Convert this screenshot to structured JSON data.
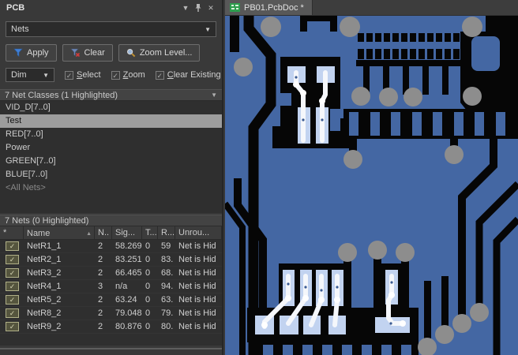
{
  "icons": {
    "combo_arrow": "▼",
    "panel_menu": "▼",
    "close": "✕",
    "check": "✓",
    "sort_asc": "▲"
  },
  "colors": {
    "panel_bg": "#393939",
    "list_bg": "#2f2f2f",
    "selected_row": "#9d9d9d",
    "board_copper_blue": "#4467a3",
    "board_clearance_black": "#060606",
    "via_gray": "#8d8d8d",
    "highlight_pad_blue": "#c2d3f0",
    "highlight_trace_white": "#f5f7fb",
    "checkbox_khaki": "#b0b088",
    "apply_funnel_blue": "#3f7fd6",
    "clear_x_red": "#d23c3c",
    "tab_icon_green": "#2e9e4e"
  },
  "panel": {
    "title": "PCB",
    "filter_combo": {
      "value": "Nets"
    },
    "toolbar": {
      "apply": "Apply",
      "clear": "Clear",
      "zoom_level": "Zoom Level..."
    },
    "dim_combo": {
      "value": "Dim"
    },
    "options": [
      {
        "key": "S",
        "rest": "elect"
      },
      {
        "key": "Z",
        "rest": "oom"
      },
      {
        "key": "C",
        "rest": "lear Existing"
      }
    ],
    "classes": {
      "header": "7 Net Classes (1 Highlighted)",
      "items": [
        "VID_D[7..0]",
        "Test",
        "RED[7..0]",
        "Power",
        "GREEN[7..0]",
        "BLUE[7..0]",
        "<All Nets>"
      ],
      "selected": "Test"
    },
    "nets": {
      "header": "7 Nets (0 Highlighted)",
      "columns": [
        "*",
        "Name",
        "N..",
        "Sig...",
        "T...",
        "R...",
        "Unrou..."
      ],
      "rows": [
        {
          "name": "NetR1_1",
          "nodes": "2",
          "signal": "58.269",
          "t": "0",
          "routed": "59",
          "unrouted": "Net is Hid"
        },
        {
          "name": "NetR2_1",
          "nodes": "2",
          "signal": "83.251",
          "t": "0",
          "routed": "83.",
          "unrouted": "Net is Hid"
        },
        {
          "name": "NetR3_2",
          "nodes": "2",
          "signal": "66.465",
          "t": "0",
          "routed": "68.",
          "unrouted": "Net is Hid"
        },
        {
          "name": "NetR4_1",
          "nodes": "3",
          "signal": "n/a",
          "t": "0",
          "routed": "94.",
          "unrouted": "Net is Hid"
        },
        {
          "name": "NetR5_2",
          "nodes": "2",
          "signal": "63.24",
          "t": "0",
          "routed": "63.",
          "unrouted": "Net is Hid"
        },
        {
          "name": "NetR8_2",
          "nodes": "2",
          "signal": "79.048",
          "t": "0",
          "routed": "79.",
          "unrouted": "Net is Hid"
        },
        {
          "name": "NetR9_2",
          "nodes": "2",
          "signal": "80.876",
          "t": "0",
          "routed": "80.",
          "unrouted": "Net is Hid"
        }
      ]
    }
  },
  "editor": {
    "tab": "PB01.PcbDoc *"
  }
}
